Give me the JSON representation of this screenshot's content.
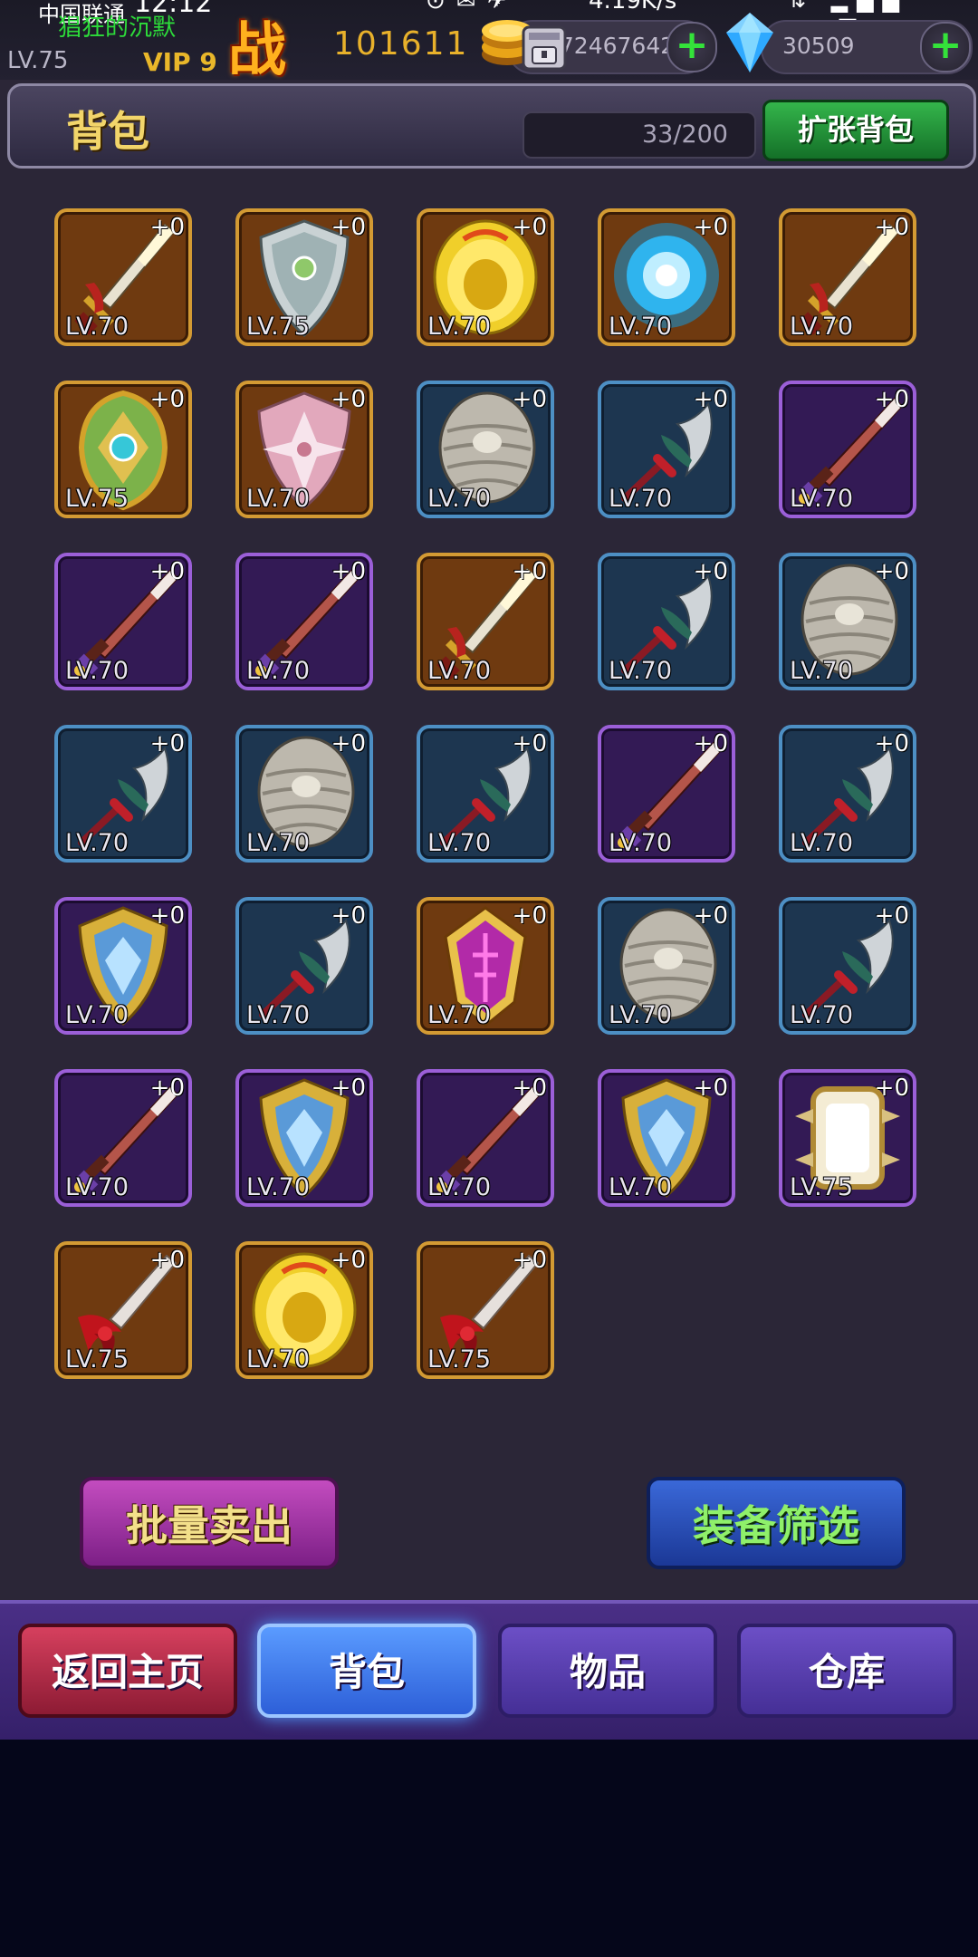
{
  "status_bar": {
    "carrier": "中国联通",
    "time": "12:12",
    "speed": "4.19K/s"
  },
  "player": {
    "name": "猖狂的沉默",
    "level": "LV.75",
    "vip": "VIP 9",
    "power_glyph": "战",
    "power": "101611"
  },
  "resources": {
    "gold": "172467642",
    "gems": "30509"
  },
  "bag": {
    "title": "背包",
    "capacity": "33/200",
    "expand_label": "扩张背包"
  },
  "items": [
    {
      "type": "sword-gold",
      "rarity": "orange",
      "plus": "+0",
      "level": "LV.70"
    },
    {
      "type": "shield-silver",
      "rarity": "orange",
      "plus": "+0",
      "level": "LV.75"
    },
    {
      "type": "shield-gold",
      "rarity": "orange",
      "plus": "+0",
      "level": "LV.70"
    },
    {
      "type": "orb-blue",
      "rarity": "orange",
      "plus": "+0",
      "level": "LV.70"
    },
    {
      "type": "sword-gold",
      "rarity": "orange",
      "plus": "+0",
      "level": "LV.70"
    },
    {
      "type": "shield-jade",
      "rarity": "orange",
      "plus": "+0",
      "level": "LV.75"
    },
    {
      "type": "shield-pink",
      "rarity": "orange",
      "plus": "+0",
      "level": "LV.70"
    },
    {
      "type": "shield-round",
      "rarity": "blue",
      "plus": "+0",
      "level": "LV.70"
    },
    {
      "type": "scimitar",
      "rarity": "blue",
      "plus": "+0",
      "level": "LV.70"
    },
    {
      "type": "sword-red",
      "rarity": "purple",
      "plus": "+0",
      "level": "LV.70"
    },
    {
      "type": "sword-red",
      "rarity": "purple",
      "plus": "+0",
      "level": "LV.70"
    },
    {
      "type": "sword-red",
      "rarity": "purple",
      "plus": "+0",
      "level": "LV.70"
    },
    {
      "type": "sword-gold",
      "rarity": "orange",
      "plus": "+0",
      "level": "LV.70"
    },
    {
      "type": "scimitar",
      "rarity": "blue",
      "plus": "+0",
      "level": "LV.70"
    },
    {
      "type": "shield-round",
      "rarity": "blue",
      "plus": "+0",
      "level": "LV.70"
    },
    {
      "type": "scimitar",
      "rarity": "blue",
      "plus": "+0",
      "level": "LV.70"
    },
    {
      "type": "shield-round",
      "rarity": "blue",
      "plus": "+0",
      "level": "LV.70"
    },
    {
      "type": "scimitar",
      "rarity": "blue",
      "plus": "+0",
      "level": "LV.70"
    },
    {
      "type": "sword-red",
      "rarity": "purple",
      "plus": "+0",
      "level": "LV.70"
    },
    {
      "type": "scimitar",
      "rarity": "blue",
      "plus": "+0",
      "level": "LV.70"
    },
    {
      "type": "shield-crystal",
      "rarity": "purple",
      "plus": "+0",
      "level": "LV.70"
    },
    {
      "type": "scimitar",
      "rarity": "blue",
      "plus": "+0",
      "level": "LV.70"
    },
    {
      "type": "shield-magenta",
      "rarity": "orange",
      "plus": "+0",
      "level": "LV.70"
    },
    {
      "type": "shield-round",
      "rarity": "blue",
      "plus": "+0",
      "level": "LV.70"
    },
    {
      "type": "scimitar",
      "rarity": "blue",
      "plus": "+0",
      "level": "LV.70"
    },
    {
      "type": "sword-red",
      "rarity": "purple",
      "plus": "+0",
      "level": "LV.70"
    },
    {
      "type": "shield-crystal",
      "rarity": "purple",
      "plus": "+0",
      "level": "LV.70"
    },
    {
      "type": "sword-red",
      "rarity": "purple",
      "plus": "+0",
      "level": "LV.70"
    },
    {
      "type": "shield-crystal",
      "rarity": "purple",
      "plus": "+0",
      "level": "LV.70"
    },
    {
      "type": "shield-spiked",
      "rarity": "purple",
      "plus": "+0",
      "level": "LV.75"
    },
    {
      "type": "sword-crimson",
      "rarity": "orange",
      "plus": "+0",
      "level": "LV.75"
    },
    {
      "type": "shield-gold",
      "rarity": "orange",
      "plus": "+0",
      "level": "LV.70"
    },
    {
      "type": "sword-crimson",
      "rarity": "orange",
      "plus": "+0",
      "level": "LV.75"
    }
  ],
  "actions": {
    "batch_sell": "批量卖出",
    "filter": "装备筛选"
  },
  "tabs": {
    "home": "返回主页",
    "bag": "背包",
    "items": "物品",
    "storage": "仓库"
  }
}
